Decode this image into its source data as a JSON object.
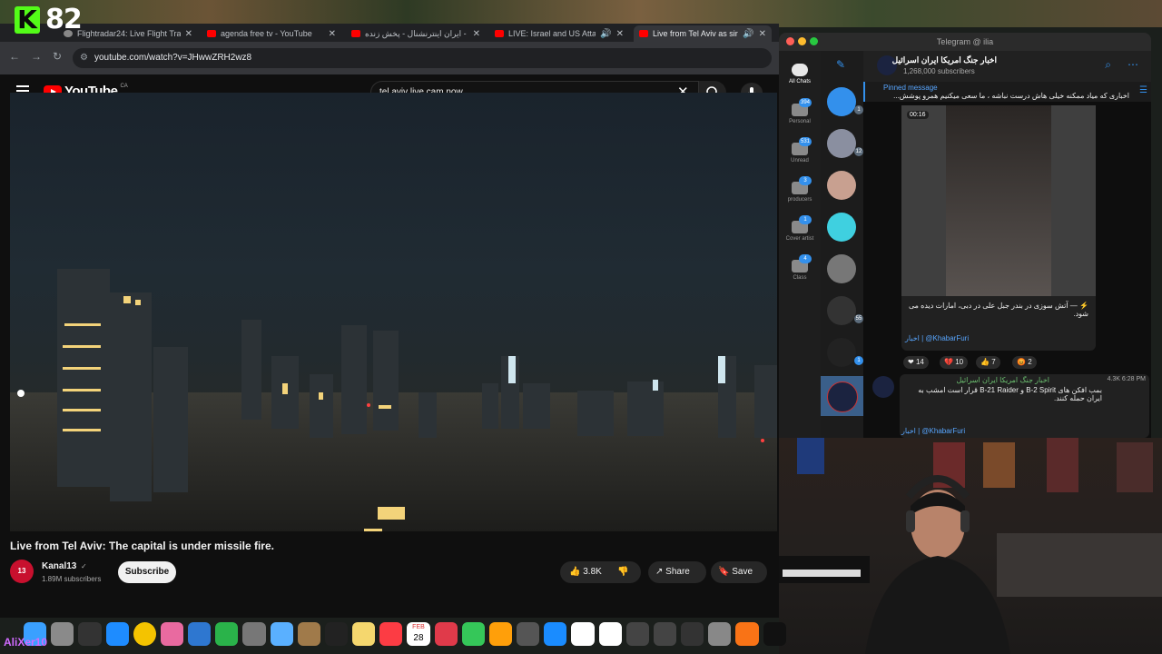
{
  "kick": {
    "viewer_count": "82"
  },
  "browser": {
    "tabs": [
      {
        "title": "Flightradar24: Live Flight Tra",
        "icon": "flightradar-icon"
      },
      {
        "title": "agenda free tv - YouTube",
        "icon": "youtube-icon"
      },
      {
        "title": "ایران اینترنشنال - پخش زنده - ...ube",
        "icon": "youtube-icon"
      },
      {
        "title": "LIVE: Israel and US Attac",
        "icon": "youtube-icon"
      },
      {
        "title": "Live from Tel Aviv as siren",
        "icon": "youtube-icon"
      }
    ],
    "url": "youtube.com/watch?v=JHwwZRH2wz8"
  },
  "youtube": {
    "logo_text": "YouTube",
    "region": "CA",
    "search_value": "tel aviv live cam now",
    "video_title": "Live from Tel Aviv: The capital is under missile fire.",
    "channel": {
      "name": "Kanal13",
      "subscribers": "1.89M subscribers",
      "avatar_text": "13"
    },
    "subscribe_label": "Subscribe",
    "likes": "3.8K",
    "share_label": "Share",
    "save_label": "Save"
  },
  "overlay": {
    "streamer_nick": "AliXer10"
  },
  "telegram": {
    "window_title": "Telegram @ ilia",
    "folders": [
      {
        "label": "All Chats",
        "badge": ""
      },
      {
        "label": "Personal",
        "badge": "394"
      },
      {
        "label": "Unread",
        "badge": "531"
      },
      {
        "label": "producers",
        "badge": "3"
      },
      {
        "label": "Cover artist",
        "badge": "1"
      },
      {
        "label": "Class",
        "badge": "4"
      }
    ],
    "chat_badges": [
      "1",
      "12",
      "",
      "",
      "",
      "55",
      "1",
      "",
      ""
    ],
    "channel_name": "اخبار جنگ امریکا ایران اسرائیل",
    "channel_subscribers": "1,268,000 subscribers",
    "pinned_label": "Pinned message",
    "pinned_text": "اخباری که میاد ممکنه خیلی هاش درست نباشه ، ما سعی میکنیم همرو پوشش...",
    "video_duration": "00:16",
    "msg1_text": "⚡️ — آتش سوزی در بندر جبل علی در دبی، امارات دیده می شود.",
    "msg1_sign": "اخبار | @KhabarFuri",
    "reactions": [
      {
        "emoji": "❤",
        "count": "14"
      },
      {
        "emoji": "💔",
        "count": "10"
      },
      {
        "emoji": "👍",
        "count": "7"
      },
      {
        "emoji": "😡",
        "count": "2"
      }
    ],
    "msg2_views": "4.3K 6:28 PM",
    "msg2_sender": "اخبار جنگ امریکا ایران اسرائیل",
    "msg2_text": "بمب افکن های B-2 Spirit و B-21 Raider قرار است امشب به ایران حمله کنند.",
    "msg2_sign": "اخبار | @KhabarFuri"
  },
  "dock": {
    "calendar_day": "28",
    "calendar_month": "FEB"
  }
}
